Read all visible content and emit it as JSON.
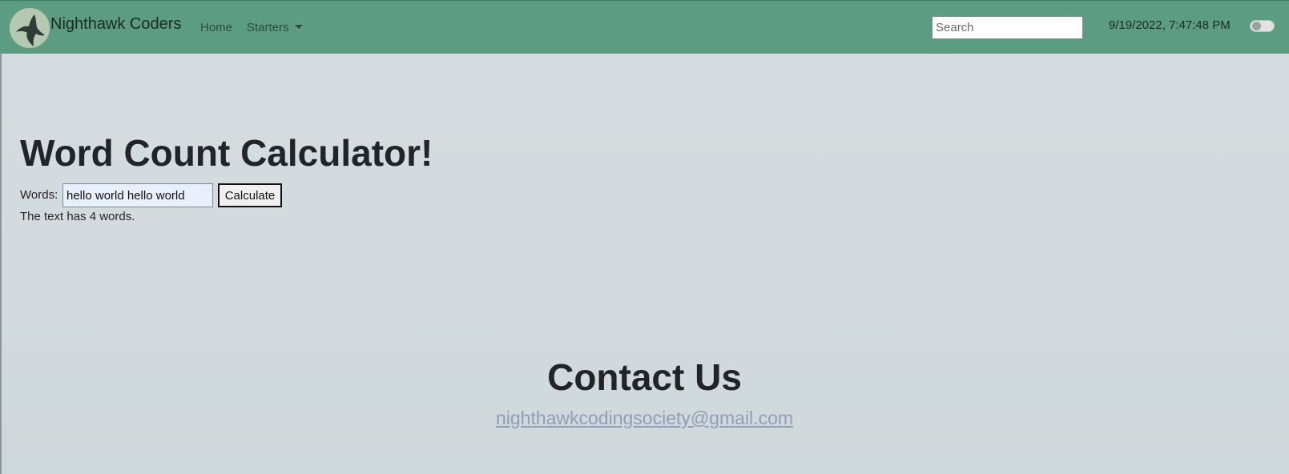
{
  "navbar": {
    "brand": "Nighthawk Coders",
    "logo_icon": "nighthawk-bird-icon",
    "links": {
      "home": "Home",
      "starters": "Starters"
    },
    "search": {
      "placeholder": "Search",
      "value": ""
    },
    "datetime": "9/19/2022, 7:47:48 PM",
    "theme_toggle": {
      "state": "off"
    },
    "background_color": "#5b9c82"
  },
  "main": {
    "title": "Word Count Calculator!",
    "words_label": "Words:",
    "words_input_value": "hello world hello world",
    "calculate_button": "Calculate",
    "result": "The text has 4 words."
  },
  "contact": {
    "title": "Contact Us",
    "email": "nighthawkcodingsociety@gmail.com"
  }
}
